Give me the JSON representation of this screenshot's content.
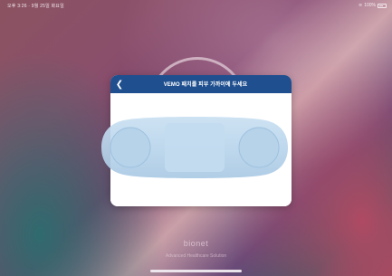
{
  "status_bar": {
    "left_text": "오후 3:26 · 9월 25일 화요일",
    "right_text": "100%"
  },
  "modal": {
    "title": "VEMO 패치를 피부 가까이에 두세요"
  },
  "brand": {
    "logo_text": "bionet",
    "tagline": "Advanced Healthcare Solution"
  },
  "colors": {
    "header": "#1f4f8f",
    "patch_fill": "#bcd7ec"
  }
}
